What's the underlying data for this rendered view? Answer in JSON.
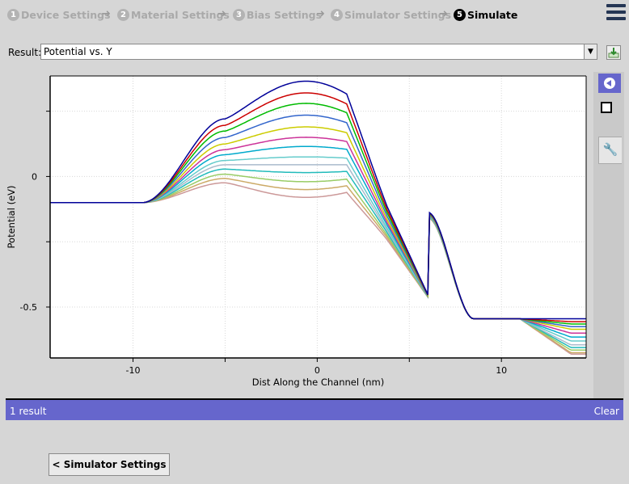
{
  "steps": [
    {
      "num": "1",
      "label": "Device Settings",
      "active": false
    },
    {
      "num": "2",
      "label": "Material Settings",
      "active": false
    },
    {
      "num": "3",
      "label": "Bias Settings",
      "active": false
    },
    {
      "num": "4",
      "label": "Simulator Settings",
      "active": false
    },
    {
      "num": "5",
      "label": "Simulate",
      "active": true
    }
  ],
  "step_arrow": "➜",
  "menu_icon": "hamburger-menu-icon",
  "result": {
    "label": "Result:",
    "value": "Potential vs. Y",
    "dropdown_glyph": "▼"
  },
  "status": {
    "left": "1 result",
    "right": "Clear"
  },
  "back_button": "< Simulator Settings",
  "sidebar_icons": [
    "play-back-icon",
    "square-icon",
    "wrench-icon"
  ],
  "chart_data": {
    "type": "line",
    "title": "",
    "xlabel": "Dist Along the Channel (nm)",
    "ylabel": "Potential (eV)",
    "xlim": [
      -14.5,
      14.6
    ],
    "ylim": [
      -0.695,
      0.385
    ],
    "xticks": [
      -10,
      0,
      10
    ],
    "xtick_labels": [
      "-10",
      "0",
      "10"
    ],
    "yticks": [
      0,
      -0.5
    ],
    "ytick_labels": [
      "0",
      "-0.5"
    ],
    "grid": true,
    "series": [
      {
        "color": "#000099",
        "peak": 0.365,
        "end": -0.545
      },
      {
        "color": "#cc0000",
        "peak": 0.32,
        "end": -0.556
      },
      {
        "color": "#00bb00",
        "peak": 0.28,
        "end": -0.565
      },
      {
        "color": "#3366cc",
        "peak": 0.235,
        "end": -0.575
      },
      {
        "color": "#cccc00",
        "peak": 0.19,
        "end": -0.585
      },
      {
        "color": "#cc3399",
        "peak": 0.15,
        "end": -0.6
      },
      {
        "color": "#00aacc",
        "peak": 0.115,
        "end": -0.615
      },
      {
        "color": "#66cccc",
        "peak": 0.075,
        "end": -0.63
      },
      {
        "color": "#aabbcc",
        "peak": 0.045,
        "end": -0.645
      },
      {
        "color": "#22bbbb",
        "peak": 0.015,
        "end": -0.655
      },
      {
        "color": "#99cc66",
        "peak": -0.02,
        "end": -0.665
      },
      {
        "color": "#ccaa66",
        "peak": -0.05,
        "end": -0.675
      },
      {
        "color": "#cc9999",
        "peak": -0.08,
        "end": -0.68
      }
    ]
  }
}
